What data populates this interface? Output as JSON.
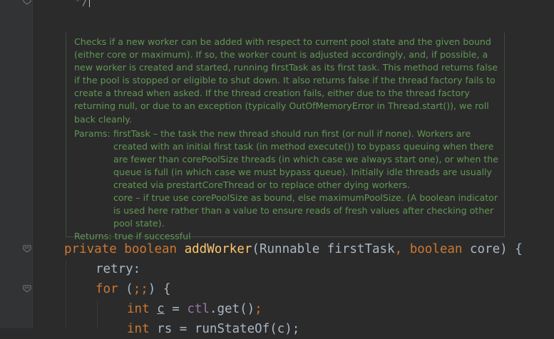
{
  "editor": {
    "comment_end": "*/",
    "doc": {
      "description": "Checks if a new worker can be added with respect to current pool state and the given bound (either core or maximum). If so, the worker count is adjusted accordingly, and, if possible, a new worker is created and started, running firstTask as its first task. This method returns false if the pool is stopped or eligible to shut down. It also returns false if the thread factory fails to create a thread when asked. If the thread creation fails, either due to the thread factory returning null, or due to an exception (typically OutOfMemoryError in Thread.start()), we roll back cleanly.",
      "params_label": "Params:",
      "param1": "firstTask – the task the new thread should run first (or null if none). Workers are created with an initial first task (in method execute()) to bypass queuing when there are fewer than corePoolSize threads (in which case we always start one), or when the queue is full (in which case we must bypass queue). Initially idle threads are usually created via prestartCoreThread or to replace other dying workers.",
      "param2": "core – if true use corePoolSize as bound, else maximumPoolSize. (A boolean indicator is used here rather than a value to ensure reads of fresh values after checking other pool state).",
      "returns_label": "Returns:",
      "returns_text": "true if successful"
    },
    "line1": {
      "kw_private": "private ",
      "kw_boolean": "boolean ",
      "method": "addWorker",
      "open": "(Runnable firstTask",
      "comma": ", ",
      "kw_boolean2": "boolean ",
      "rest": "core) {"
    },
    "line2": {
      "label": "retry:"
    },
    "line3": {
      "kw_for": "for ",
      "paren": "(",
      "semis": ";;",
      "rest": ") {"
    },
    "line4": {
      "kw_int": "int ",
      "var": "c",
      "eq": " = ",
      "field": "ctl",
      "call": ".get()",
      "semi": ";"
    },
    "line5": {
      "kw_int": "int ",
      "var": "rs",
      "eq": " = ",
      "call": "runStateOf(c);"
    }
  },
  "colors": {
    "background": "#2b2b2b",
    "gutter": "#313335",
    "keyword": "#cc7832",
    "method": "#ffc66d",
    "doc_text": "#629755",
    "field": "#9876aa",
    "default_text": "#a9b7c6"
  }
}
